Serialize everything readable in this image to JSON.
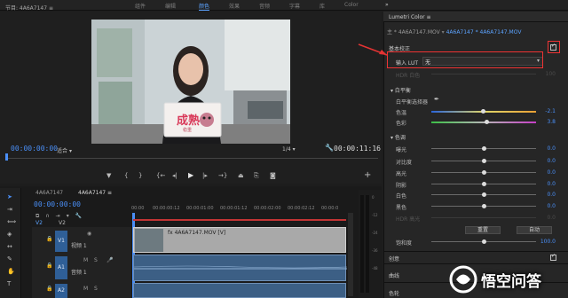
{
  "topbar": {
    "workspaces": [
      "组件",
      "编辑",
      "颜色",
      "效果",
      "音频",
      "字幕",
      "库",
      "Color"
    ],
    "active": "颜色"
  },
  "monitor": {
    "title": "节目: 4A6A7147 ≡",
    "timecode_left": "00:00:00:00",
    "fit_label": "适合",
    "scale": "1/4",
    "timecode_right": "00:00:11:16",
    "sign_text": "成熟",
    "sign_sub": "稳重"
  },
  "timeline": {
    "seq_tab_1": "4A6A7147",
    "seq_tab_2": "4A6A7147 ≡",
    "timecode": "00:00:00:00",
    "ruler": [
      "00:00",
      "00:00:00:12",
      "00:00:01:00",
      "00:00:01:12",
      "00:00:02:00",
      "00:00:02:12",
      "00:00:0"
    ],
    "tracks": {
      "v2": "V2",
      "v1": "V1",
      "v1_name": "视频 1",
      "a1": "A1",
      "a1_name": "音频 1",
      "a2": "A2"
    },
    "clip_label": "fx 4A6A7147.MOV [V]",
    "meter_labels": [
      "0",
      "-12",
      "-24",
      "-36",
      "-48"
    ]
  },
  "lumetri": {
    "title": "Lumetri Color ≡",
    "clip_prefix": "主 * 4A6A7147.MOV",
    "clip_active": "4A6A7147 * 4A6A7147.MOV",
    "basic": "基本校正",
    "lut_label": "输入 LUT",
    "lut_value": "无",
    "hdr_label": "HDR 白色",
    "hdr_value": "100",
    "wb": "白平衡",
    "wb_picker": "白平衡选择器",
    "temp": "色温",
    "temp_val": "-2.1",
    "tint": "色彩",
    "tint_val": "3.8",
    "tone": "色调",
    "exposure": "曝光",
    "exposure_val": "0.0",
    "contrast": "对比度",
    "contrast_val": "0.0",
    "highlights": "高光",
    "highlights_val": "0.0",
    "shadows": "阴影",
    "shadows_val": "0.0",
    "whites": "白色",
    "whites_val": "0.0",
    "blacks": "黑色",
    "blacks_val": "0.0",
    "hdr_spec": "HDR 高光",
    "hdr_spec_val": "0.0",
    "btn_reset": "重置",
    "btn_auto": "自动",
    "saturation": "饱和度",
    "saturation_val": "100.0",
    "creative": "创意",
    "curves": "曲线",
    "color_wheels": "色轮"
  },
  "watermark": {
    "text": "悟空问答"
  },
  "colors": {
    "accent": "#4a8ff7",
    "annotation": "#e33333",
    "clip_video": "#a9a9a9",
    "clip_audio": "#3c5f85"
  }
}
